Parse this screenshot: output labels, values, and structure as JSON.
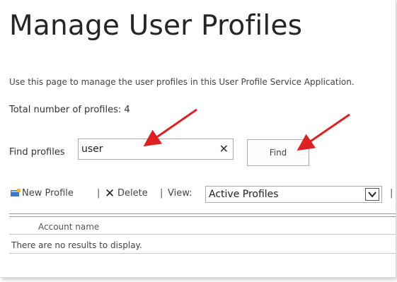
{
  "page": {
    "title": "Manage User Profiles",
    "description": "Use this page to manage the user profiles in this User Profile Service Application.",
    "total_profiles": "Total number of profiles: 4"
  },
  "search": {
    "label": "Find profiles",
    "value": "user",
    "clear_glyph": "✕",
    "find_label": "Find"
  },
  "toolbar": {
    "new_profile": "New Profile",
    "separator": "|",
    "delete_glyph": "✕",
    "delete": "Delete",
    "view_label": "View:",
    "view_value": "Active Profiles"
  },
  "table": {
    "columns": [
      "Account name"
    ],
    "empty_message": "There are no results to display."
  },
  "colors": {
    "annotation_arrow": "#e02020",
    "text": "#333333",
    "border": "#ababab"
  },
  "icons": {
    "new_profile": "new-profile-icon",
    "delete": "delete-icon",
    "clear": "clear-icon",
    "dropdown": "chevron-down-icon"
  }
}
